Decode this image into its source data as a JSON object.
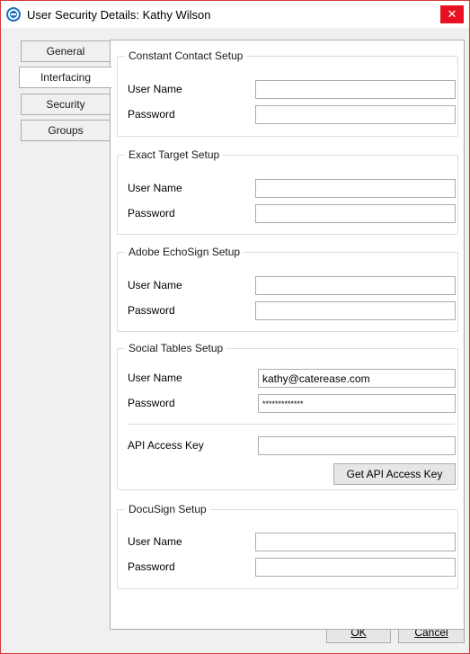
{
  "window": {
    "title": "User Security Details:  Kathy Wilson",
    "close_label": "✕"
  },
  "tabs": [
    {
      "label": "General"
    },
    {
      "label": "Interfacing",
      "active": true
    },
    {
      "label": "Security"
    },
    {
      "label": "Groups"
    }
  ],
  "groups": {
    "constant_contact": {
      "title": "Constant Contact Setup",
      "user_name_label": "User Name",
      "user_name_value": "",
      "password_label": "Password",
      "password_value": ""
    },
    "exact_target": {
      "title": "Exact Target Setup",
      "user_name_label": "User Name",
      "user_name_value": "",
      "password_label": "Password",
      "password_value": ""
    },
    "adobe_echosign": {
      "title": "Adobe EchoSign Setup",
      "user_name_label": "User Name",
      "user_name_value": "",
      "password_label": "Password",
      "password_value": ""
    },
    "social_tables": {
      "title": "Social Tables Setup",
      "user_name_label": "User Name",
      "user_name_value": "kathy@caterease.com",
      "password_label": "Password",
      "password_value": "*************",
      "api_key_label": "API Access Key",
      "api_key_value": "",
      "get_api_button": "Get API Access Key"
    },
    "docusign": {
      "title": "DocuSign Setup",
      "user_name_label": "User Name",
      "user_name_value": "",
      "password_label": "Password",
      "password_value": ""
    }
  },
  "footer": {
    "ok_label": "OK",
    "cancel_label": "Cancel"
  },
  "colors": {
    "accent": "#1e73be",
    "close": "#e81123",
    "window_border": "#d23a3a"
  }
}
